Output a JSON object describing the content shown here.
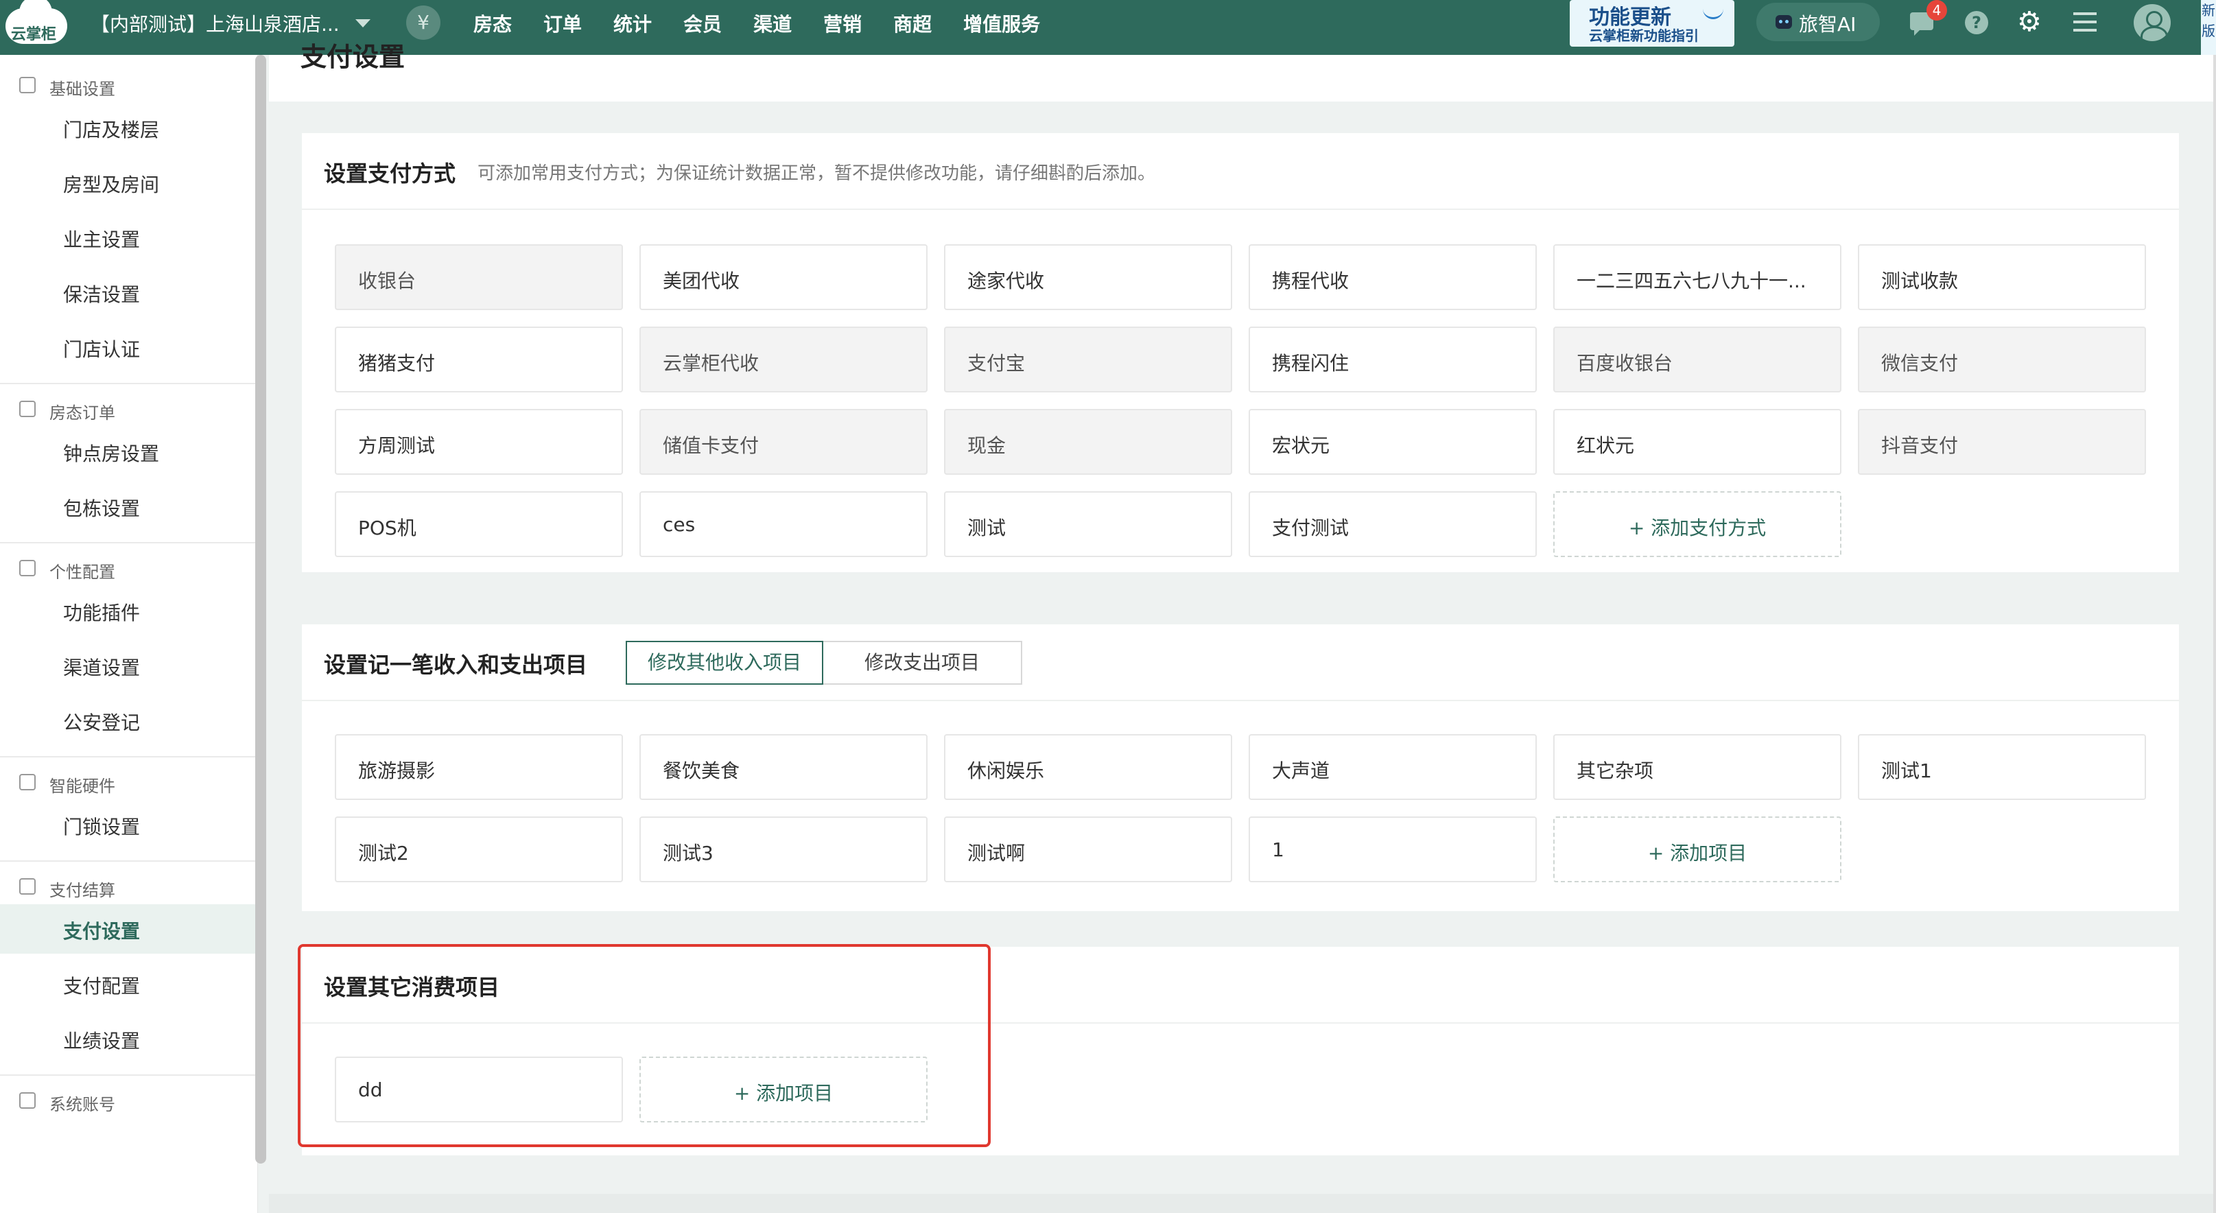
{
  "topbar": {
    "logo_text": "云掌柜",
    "hotel_name": "【内部测试】上海山泉酒店...",
    "yen_symbol": "¥",
    "nav": [
      "房态",
      "订单",
      "统计",
      "会员",
      "渠道",
      "营销",
      "商超",
      "增值服务"
    ],
    "promo_title": "功能更新",
    "promo_sub": "云掌柜新功能指引",
    "ai_label": "旅智AI",
    "message_count": "4",
    "help_symbol": "?",
    "gear_symbol": "⚙",
    "edge_tag": "新版",
    "colors": {
      "bar": "#2e6a5c",
      "badge": "#e6453a"
    }
  },
  "sidebar": {
    "groups": [
      {
        "label": "基础设置",
        "icon": "home-icon",
        "items": [
          "门店及楼层",
          "房型及房间",
          "业主设置",
          "保洁设置",
          "门店认证"
        ]
      },
      {
        "label": "房态订单",
        "icon": "calendar-icon",
        "items": [
          "钟点房设置",
          "包栋设置"
        ]
      },
      {
        "label": "个性配置",
        "icon": "sliders-icon",
        "items": [
          "功能插件",
          "渠道设置",
          "公安登记"
        ]
      },
      {
        "label": "智能硬件",
        "icon": "device-icon",
        "items": [
          "门锁设置"
        ]
      },
      {
        "label": "支付结算",
        "icon": "yen-icon",
        "items": [
          "支付设置",
          "支付配置",
          "业绩设置"
        ]
      },
      {
        "label": "系统账号",
        "icon": "shield-icon",
        "items": []
      }
    ],
    "active_item": "支付设置"
  },
  "page": {
    "title": "支付设置"
  },
  "payment_methods": {
    "title": "设置支付方式",
    "subtitle": "可添加常用支付方式；为保证统计数据正常，暂不提供修改功能，请仔细斟酌后添加。",
    "items": [
      {
        "label": "收银台",
        "grey": true
      },
      {
        "label": "美团代收",
        "grey": false
      },
      {
        "label": "途家代收",
        "grey": false
      },
      {
        "label": "携程代收",
        "grey": false
      },
      {
        "label": "一二三四五六七八九十一...",
        "grey": false
      },
      {
        "label": "测试收款",
        "grey": false
      },
      {
        "label": "猪猪支付",
        "grey": false
      },
      {
        "label": "云掌柜代收",
        "grey": true
      },
      {
        "label": "支付宝",
        "grey": true
      },
      {
        "label": "携程闪住",
        "grey": false
      },
      {
        "label": "百度收银台",
        "grey": true
      },
      {
        "label": "微信支付",
        "grey": true
      },
      {
        "label": "方周测试",
        "grey": false
      },
      {
        "label": "储值卡支付",
        "grey": true
      },
      {
        "label": "现金",
        "grey": true
      },
      {
        "label": "宏状元",
        "grey": false
      },
      {
        "label": "红状元",
        "grey": false
      },
      {
        "label": "抖音支付",
        "grey": true
      },
      {
        "label": "POS机",
        "grey": false
      },
      {
        "label": "ces",
        "grey": false
      },
      {
        "label": "测试",
        "grey": false
      },
      {
        "label": "支付测试",
        "grey": false
      }
    ],
    "add_label": "+ 添加支付方式"
  },
  "income_expense": {
    "title": "设置记一笔收入和支出项目",
    "tabs": [
      "修改其他收入项目",
      "修改支出项目"
    ],
    "active_tab": 0,
    "items": [
      "旅游摄影",
      "餐饮美食",
      "休闲娱乐",
      "大声道",
      "其它杂项",
      "测试1",
      "测试2",
      "测试3",
      "测试啊",
      "1"
    ],
    "add_label": "+ 添加项目"
  },
  "other_consumption": {
    "title": "设置其它消费项目",
    "items": [
      "dd"
    ],
    "add_label": "+ 添加项目",
    "highlight_color": "#e0382f"
  }
}
